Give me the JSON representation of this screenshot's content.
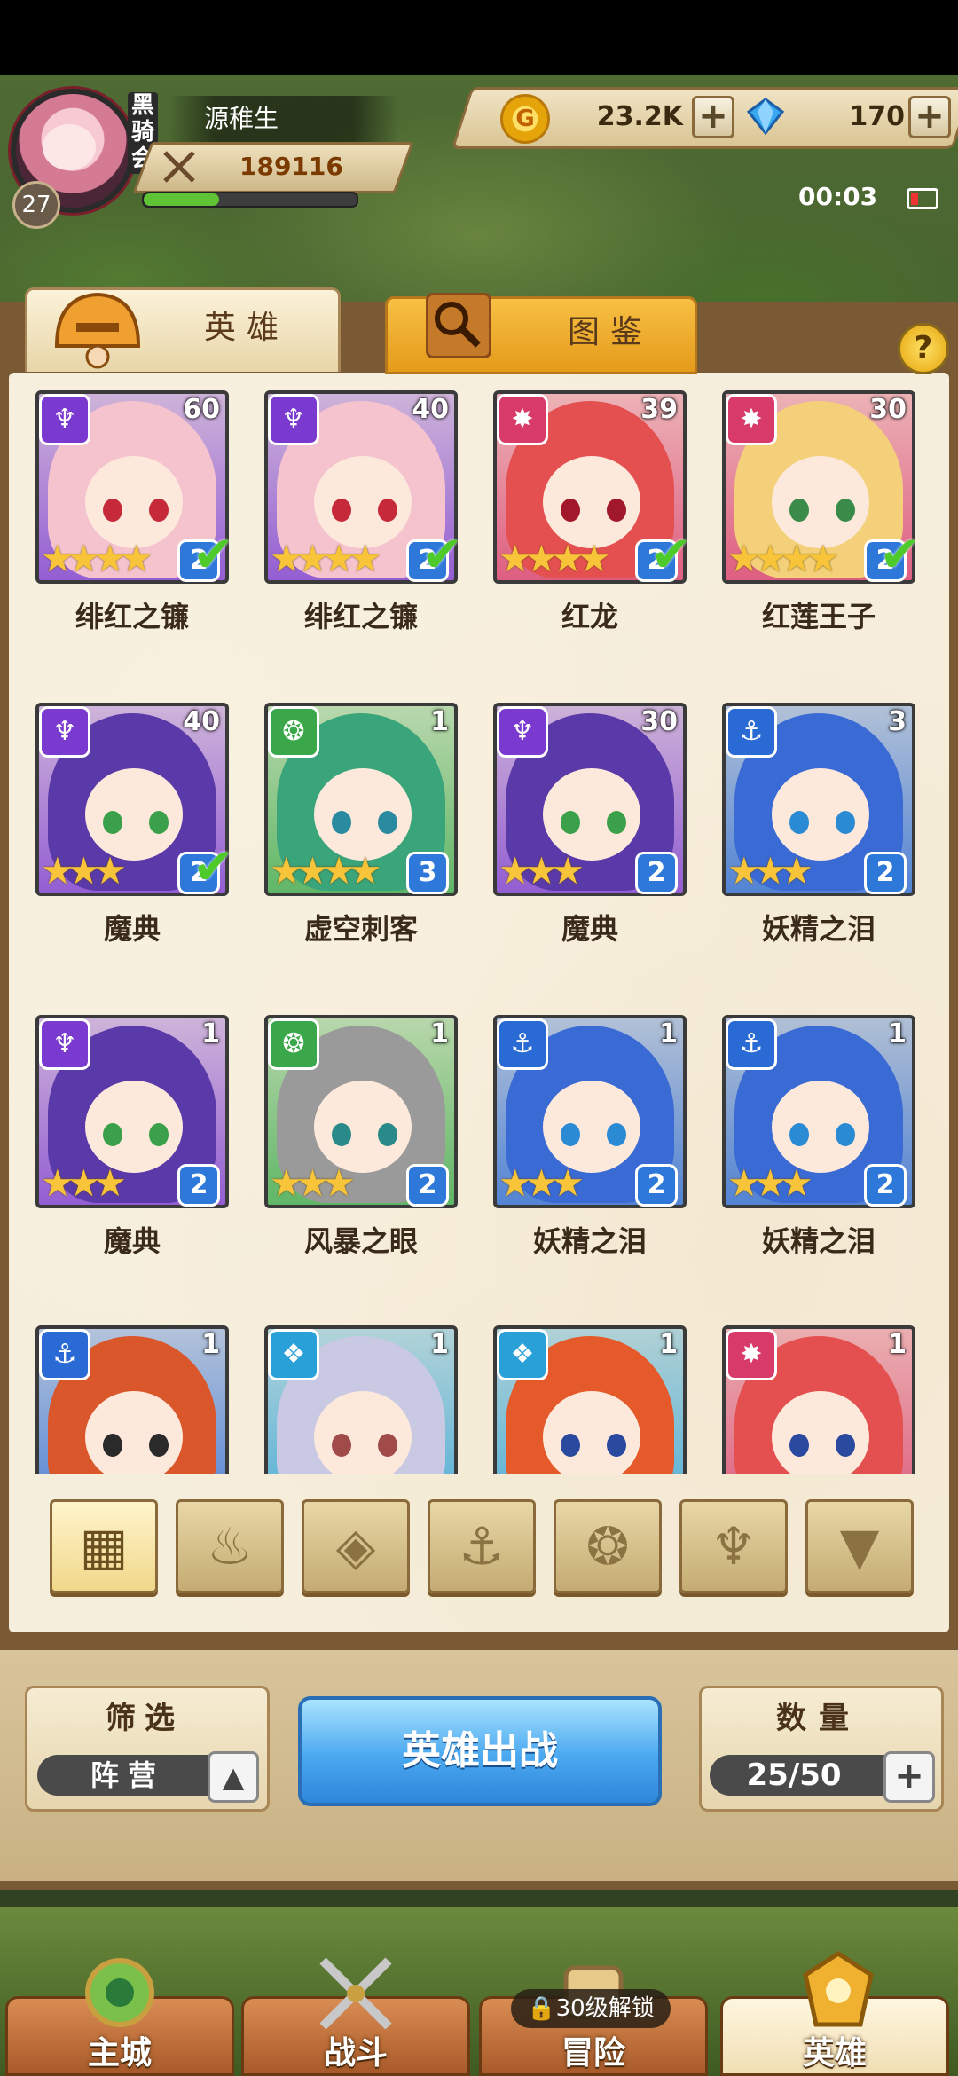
{
  "player": {
    "name": "源稚生",
    "clan_tag": "黑\n骑\n会",
    "level": "27",
    "power": "189116",
    "exp_fraction": 0.36
  },
  "currency": {
    "gold": "23.2K",
    "gold_icon_letter": "G",
    "gems": "170",
    "plus_symbol": "+"
  },
  "status": {
    "clock": "00:03"
  },
  "tabs": {
    "heroes": "英雄",
    "codex": "图鉴",
    "help": "?"
  },
  "faction_icons": {
    "demon": "♆",
    "fire": "✸",
    "beast": "❂",
    "sea": "⚓",
    "crystal": "❖"
  },
  "heroes": [
    {
      "name": "绯红之镰",
      "level": "60",
      "faction": "demon",
      "stars": "★★★★",
      "rank": "2",
      "checked": true,
      "hair": "#f5c3ce",
      "eye": "#c62a3a"
    },
    {
      "name": "绯红之镰",
      "level": "40",
      "faction": "demon",
      "stars": "★★★★",
      "rank": "2",
      "checked": true,
      "hair": "#f5c3ce",
      "eye": "#c62a3a"
    },
    {
      "name": "红龙",
      "level": "39",
      "faction": "fire",
      "stars": "★★★★",
      "rank": "2",
      "checked": true,
      "hair": "#e4504f",
      "eye": "#a0182a"
    },
    {
      "name": "红莲王子",
      "level": "30",
      "faction": "fire",
      "stars": "★★★★",
      "rank": "2",
      "checked": true,
      "hair": "#f3d079",
      "eye": "#3a8a4a"
    },
    {
      "name": "魔典",
      "level": "40",
      "faction": "demon",
      "stars": "★★★",
      "rank": "2",
      "checked": true,
      "hair": "#5a3aa8",
      "eye": "#3aa04a"
    },
    {
      "name": "虚空刺客",
      "level": "1",
      "faction": "beast",
      "stars": "★★★★",
      "rank": "3",
      "checked": false,
      "hair": "#3aa47a",
      "eye": "#2a8aa0"
    },
    {
      "name": "魔典",
      "level": "30",
      "faction": "demon",
      "stars": "★★★",
      "rank": "2",
      "checked": false,
      "hair": "#5a3aa8",
      "eye": "#3aa04a"
    },
    {
      "name": "妖精之泪",
      "level": "3",
      "faction": "sea",
      "stars": "★★★",
      "rank": "2",
      "checked": false,
      "hair": "#3a6ad4",
      "eye": "#2a8ad4"
    },
    {
      "name": "魔典",
      "level": "1",
      "faction": "demon",
      "stars": "★★★",
      "rank": "2",
      "checked": false,
      "hair": "#5a3aa8",
      "eye": "#3aa04a"
    },
    {
      "name": "风暴之眼",
      "level": "1",
      "faction": "beast",
      "stars": "★★★",
      "rank": "2",
      "checked": false,
      "hair": "#9a9a9a",
      "eye": "#2a8a8a"
    },
    {
      "name": "妖精之泪",
      "level": "1",
      "faction": "sea",
      "stars": "★★★",
      "rank": "2",
      "checked": false,
      "hair": "#3a6ad4",
      "eye": "#2a8ad4"
    },
    {
      "name": "妖精之泪",
      "level": "1",
      "faction": "sea",
      "stars": "★★★",
      "rank": "2",
      "checked": false,
      "hair": "#3a6ad4",
      "eye": "#2a8ad4"
    },
    {
      "name": "",
      "level": "1",
      "faction": "sea",
      "stars": "",
      "rank": "",
      "checked": false,
      "hair": "#d9572a",
      "eye": "#2a2a2a"
    },
    {
      "name": "",
      "level": "1",
      "faction": "crystal",
      "stars": "",
      "rank": "",
      "checked": false,
      "hair": "#c9c9e4",
      "eye": "#a04a4a"
    },
    {
      "name": "",
      "level": "1",
      "faction": "crystal",
      "stars": "",
      "rank": "",
      "checked": false,
      "hair": "#e45a2a",
      "eye": "#2a4aa0"
    },
    {
      "name": "",
      "level": "1",
      "faction": "fire",
      "stars": "",
      "rank": "",
      "checked": false,
      "hair": "#e4504f",
      "eye": "#2a4aa0"
    }
  ],
  "faction_colors": {
    "demon": "#7a3ad0",
    "fire": "#d83a6a",
    "beast": "#3aa84a",
    "sea": "#2a6ad4",
    "crystal": "#2aa0d8"
  },
  "filters": [
    {
      "name": "filter-all",
      "glyph": "▦"
    },
    {
      "name": "filter-fire",
      "glyph": "♨"
    },
    {
      "name": "filter-crystal",
      "glyph": "◈"
    },
    {
      "name": "filter-sea",
      "glyph": "⚓"
    },
    {
      "name": "filter-beast",
      "glyph": "❂"
    },
    {
      "name": "filter-demon",
      "glyph": "♆"
    },
    {
      "name": "filter-void",
      "glyph": "▼"
    }
  ],
  "controls": {
    "sort_label": "筛选",
    "sort_value": "阵营",
    "sort_arrow": "▲",
    "deploy": "英雄出战",
    "count_label": "数量",
    "count_value": "25/50"
  },
  "nav": [
    {
      "label": "主城"
    },
    {
      "label": "战斗"
    },
    {
      "label": "冒险"
    },
    {
      "label": "英雄"
    }
  ],
  "nav_lock": "🔒30级解锁"
}
